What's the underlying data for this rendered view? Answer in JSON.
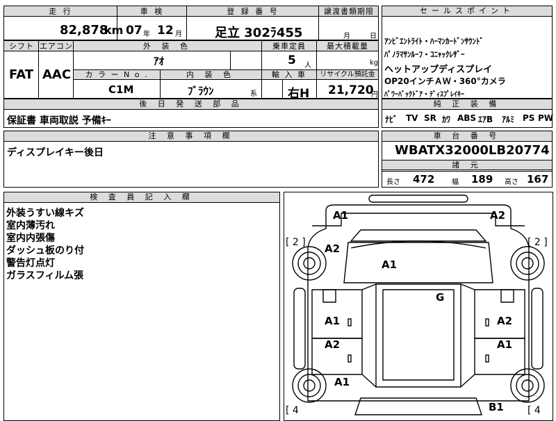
{
  "header": {
    "mileage_label": "走 行",
    "mileage_value": "82,878",
    "mileage_unit": "km",
    "inspection_label": "車 検",
    "inspection_year": "07",
    "inspection_year_unit": "年",
    "inspection_month": "12",
    "inspection_month_unit": "月",
    "plate_label": "登 録 番 号",
    "plate_value": "足立 302ﾗ455",
    "transfer_label": "譲渡書類期限",
    "transfer_month_unit": "月",
    "transfer_day_unit": "日"
  },
  "spec": {
    "shift_label": "シフト",
    "shift_value": "FAT",
    "ac_label": "エアコン",
    "ac_value": "AAC",
    "exterior_label": "外 装 色",
    "exterior_value": "ｱｵ",
    "capacity_label": "乗車定員",
    "capacity_value": "5",
    "capacity_unit": "人",
    "max_load_label": "最大積載量",
    "max_load_unit": "kg",
    "color_no_label": "カ ラ ー N o .",
    "color_no_value": "C1M",
    "interior_label": "内 装 色",
    "interior_value": "ﾌﾞﾗｳﾝ",
    "interior_suffix": "系",
    "import_label": "輸 入 車",
    "import_value": "右H",
    "recycle_label": "リサイクル預託金",
    "recycle_value": "21,720",
    "recycle_unit": "円"
  },
  "sales_points": {
    "header": "セールスポイント",
    "lines": [
      "ｱﾝﾋﾞｴﾝﾄﾗｲﾄ・ﾊｰﾏﾝｶｰﾄﾞﾝｻｳﾝﾄﾞ",
      "ﾊﾟﾉﾗﾏｻﾝﾙｰﾌ・ｺﾆｬｯｸﾚｻﾞｰ",
      "ヘットアップディスプレイ",
      "OP20インチＡＷ・360°カメラ",
      "ﾊﾟﾜｰﾊﾞｯｸﾄﾞｱ・ﾃﾞｨｽﾌﾟﾚｲｷｰ"
    ]
  },
  "later_parts": {
    "header": "後 日 発 送 部 品",
    "value": "保証書 車両取説 予備ｷｰ"
  },
  "genuine": {
    "header": "純 正 装 備",
    "items": [
      "ﾅﾋﾞ",
      "TV",
      "SR",
      "ｶﾜ",
      "ABS",
      "ｴｱB",
      "ｱﾙﾐ",
      "PS",
      "PW"
    ]
  },
  "notes": {
    "header": "注 意 事 項 欄",
    "value": "ディスプレイキー後日"
  },
  "chassis": {
    "header": "車 台 番 号",
    "value": "WBATX32000LB20774",
    "dims_header": "諸 元",
    "length_label": "長さ",
    "length_value": "472",
    "width_label": "幅",
    "width_value": "189",
    "height_label": "高さ",
    "height_value": "167"
  },
  "inspector": {
    "header": "検 査 員 記 入 欄",
    "lines": [
      "外装うすい線キズ",
      "室内薄汚れ",
      "室内内張傷",
      "ダッシュ板のり付",
      "警告灯点灯",
      "ガラスフィルム張"
    ]
  },
  "diagram": {
    "marks": [
      "A1",
      "A2",
      "A2",
      "A1",
      "G",
      "A1",
      "A2",
      "A2",
      "A1",
      "A1",
      "B1"
    ],
    "tire_left_top": "[ 2 ]",
    "tire_right_top": "[ 2 ]",
    "tire_left_bottom": "[ 4",
    "tire_right_bottom": "[ 4"
  }
}
